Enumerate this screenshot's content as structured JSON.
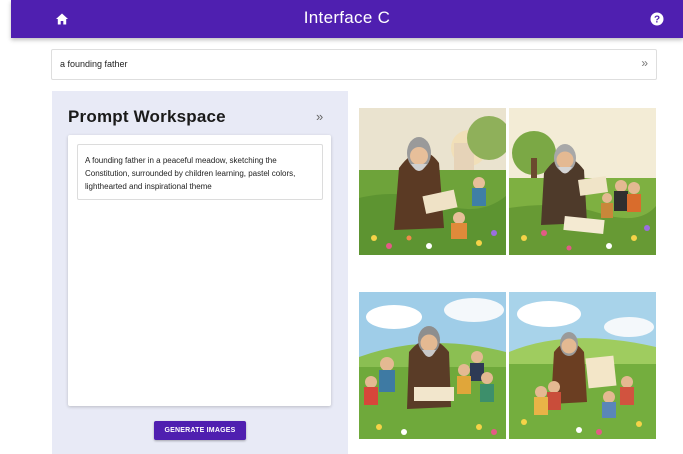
{
  "header": {
    "title": "Interface C",
    "home_icon": "home-icon",
    "help_icon": "help-icon"
  },
  "search": {
    "value": "a founding father",
    "expand_icon": "double-chevron-right-icon"
  },
  "workspace": {
    "title": "Prompt Workspace",
    "collapse_icon": "double-chevron-right-icon",
    "prompt_text": "A founding father in a peaceful meadow, sketching the Constitution, surrounded by children learning, pastel colors, lighthearted and inspirational theme",
    "generate_label": "GENERATE IMAGES"
  },
  "colors": {
    "accent": "#4f1fb0",
    "panel_bg": "#e8eaf6"
  }
}
